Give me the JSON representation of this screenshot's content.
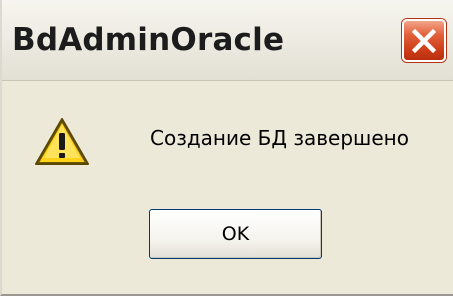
{
  "window": {
    "title": "BdAdminOracle",
    "close_icon": "close-x-icon"
  },
  "dialog": {
    "icon": "warning-icon",
    "message": "Создание БД завершено",
    "ok_label": "OK"
  },
  "colors": {
    "dialog_background": "#ece9d8",
    "close_button": "#cc3c18",
    "warning_yellow": "#ffd21a",
    "button_border": "#003c74"
  }
}
